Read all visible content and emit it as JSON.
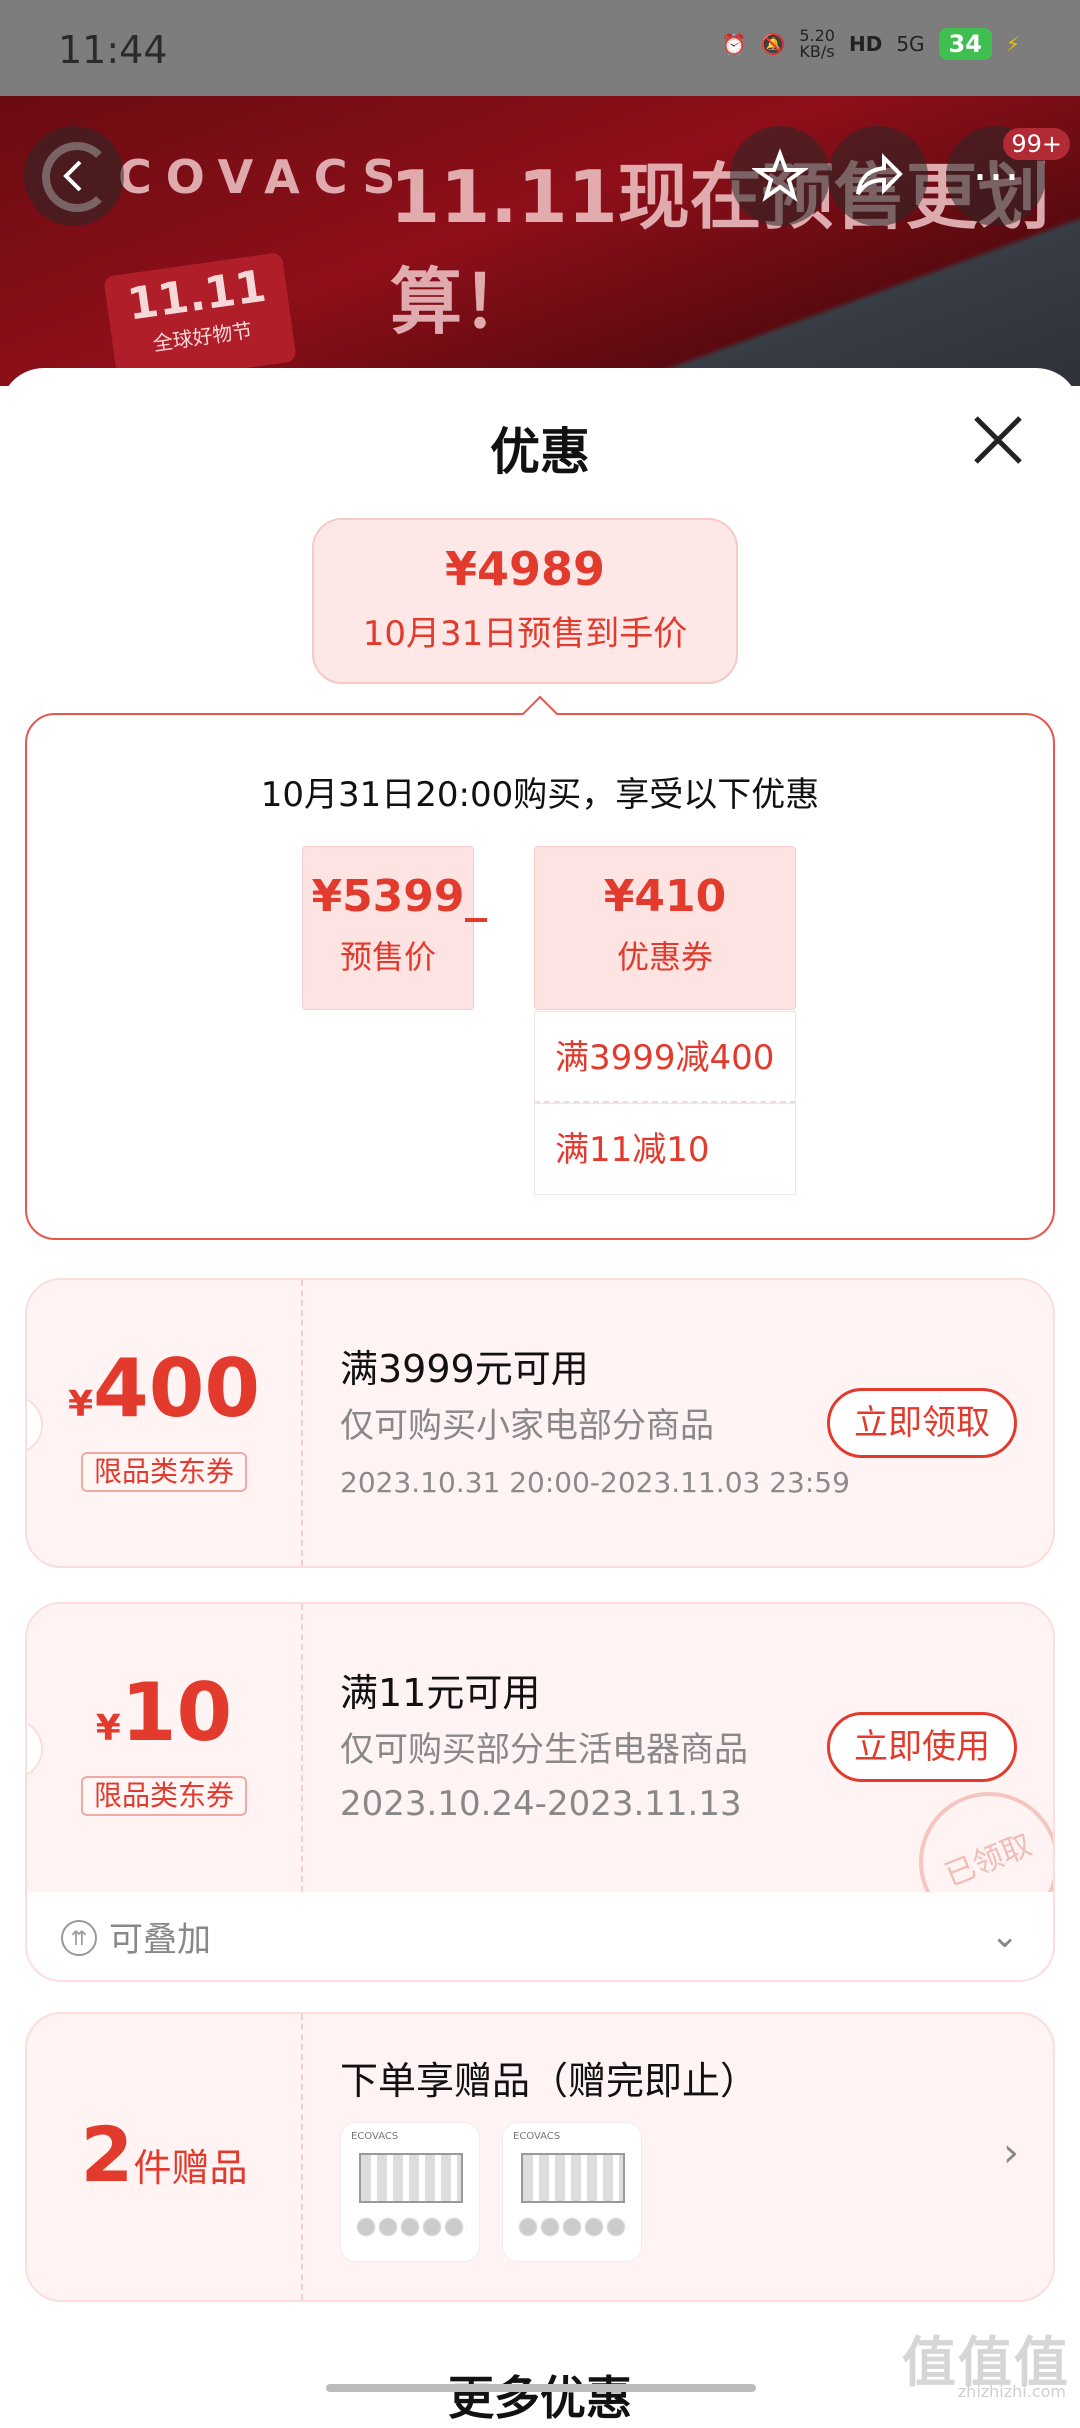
{
  "status_bar": {
    "time": "11:44",
    "speed": "5.20\nKB/s",
    "network": "5G",
    "battery": "34"
  },
  "banner": {
    "brand": "COVACS",
    "title": "11.11现在预售更划算！",
    "event_logo": "11.11",
    "event_name": "全球好物节",
    "cart_badge": "99+"
  },
  "sheet": {
    "title": "优惠",
    "final_price": "¥4989",
    "final_price_label": "10月31日预售到手价",
    "calc_header": "10月31日20:00购买，享受以下优惠",
    "presale_price": "¥5399",
    "presale_label": "预售价",
    "coupon_total": "¥410",
    "coupon_label": "优惠券",
    "rules": [
      "满3999减400",
      "满11减10"
    ]
  },
  "coupons": [
    {
      "symbol": "¥",
      "amount": "400",
      "category": "限品类东券",
      "title": "满3999元可用",
      "scope": "仅可购买小家电部分商品",
      "period": "2023.10.31 20:00-2023.11.03 23:59",
      "action": "立即领取"
    },
    {
      "symbol": "¥",
      "amount": "10",
      "category": "限品类东券",
      "title": "满11元可用",
      "scope": "仅可购买部分生活电器商品",
      "period": "2023.10.24-2023.11.13",
      "action": "立即使用",
      "stamp": "已领取"
    }
  ],
  "stack_note": "可叠加",
  "gift": {
    "count": "2",
    "unit": "件赠品",
    "title": "下单享赠品（赠完即止）",
    "item_label": "ECOVACS"
  },
  "more_title": "更多优惠",
  "watermark": {
    "text": "值值值",
    "url": "zhizhizhi.com"
  }
}
